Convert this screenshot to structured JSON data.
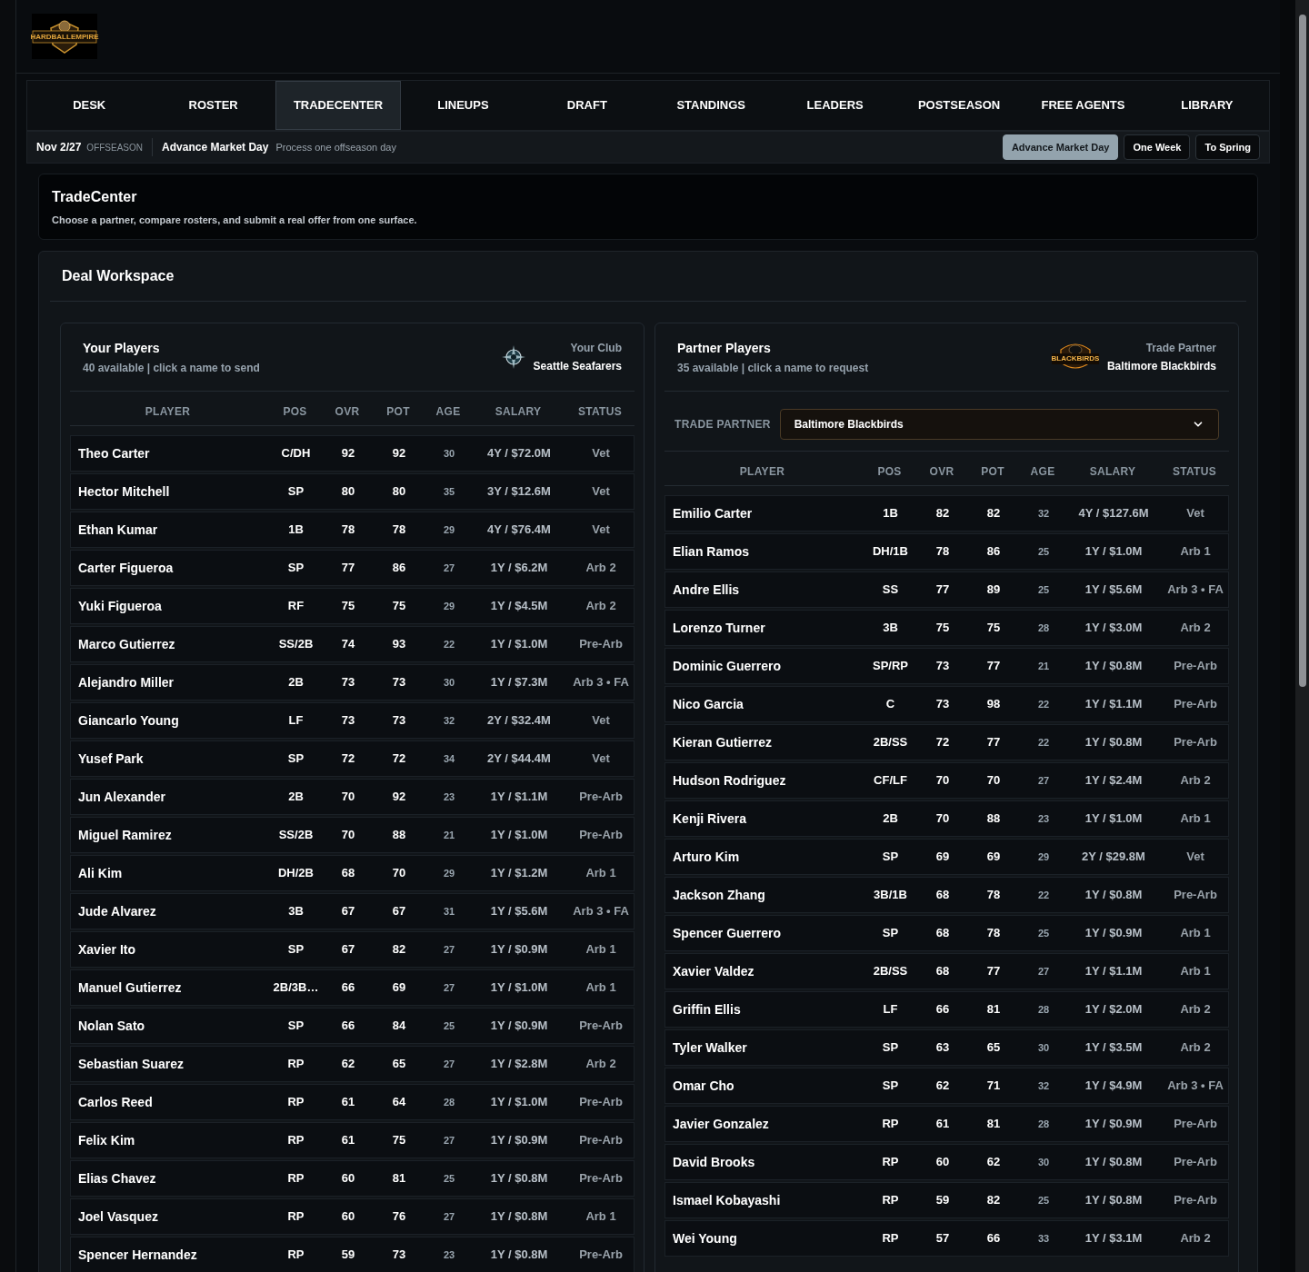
{
  "header": {
    "logo_text": "HARDBALLEMPIRE"
  },
  "nav": [
    {
      "label": "DESK",
      "selected": false
    },
    {
      "label": "ROSTER",
      "selected": false
    },
    {
      "label": "TRADECENTER",
      "selected": true
    },
    {
      "label": "LINEUPS",
      "selected": false
    },
    {
      "label": "DRAFT",
      "selected": false
    },
    {
      "label": "STANDINGS",
      "selected": false
    },
    {
      "label": "LEADERS",
      "selected": false
    },
    {
      "label": "POSTSEASON",
      "selected": false
    },
    {
      "label": "FREE AGENTS",
      "selected": false
    },
    {
      "label": "LIBRARY",
      "selected": false
    }
  ],
  "status_bar": {
    "date": "Nov 2/27",
    "phase": "OFFSEASON",
    "action": "Advance Market Day",
    "action_hint": "Process one offseason day",
    "buttons": [
      {
        "label": "Advance Market Day",
        "selected": true
      },
      {
        "label": "One Week",
        "selected": false
      },
      {
        "label": "To Spring",
        "selected": false
      }
    ]
  },
  "intro": {
    "title": "TradeCenter",
    "subtitle": "Choose a partner, compare rosters, and submit a real offer from one surface."
  },
  "workspace": {
    "title": "Deal Workspace",
    "panels": [
      {
        "kind": "own",
        "title": "Your Players",
        "subtitle": "40 available | click a name to send",
        "club_label": "Your Club",
        "club_name": "Seattle Seafarers",
        "columns": [
          "PLAYER",
          "POS",
          "OVR",
          "POT",
          "AGE",
          "SALARY",
          "STATUS"
        ],
        "rows": [
          [
            "Theo Carter",
            "C/DH",
            "92",
            "92",
            "30",
            "4Y / $72.0M",
            "Vet"
          ],
          [
            "Hector Mitchell",
            "SP",
            "80",
            "80",
            "35",
            "3Y / $12.6M",
            "Vet"
          ],
          [
            "Ethan Kumar",
            "1B",
            "78",
            "78",
            "29",
            "4Y / $76.4M",
            "Vet"
          ],
          [
            "Carter Figueroa",
            "SP",
            "77",
            "86",
            "27",
            "1Y / $6.2M",
            "Arb 2"
          ],
          [
            "Yuki Figueroa",
            "RF",
            "75",
            "75",
            "29",
            "1Y / $4.5M",
            "Arb 2"
          ],
          [
            "Marco Gutierrez",
            "SS/2B",
            "74",
            "93",
            "22",
            "1Y / $1.0M",
            "Pre-Arb"
          ],
          [
            "Alejandro Miller",
            "2B",
            "73",
            "73",
            "30",
            "1Y / $7.3M",
            "Arb 3 • FA"
          ],
          [
            "Giancarlo Young",
            "LF",
            "73",
            "73",
            "32",
            "2Y / $32.4M",
            "Vet"
          ],
          [
            "Yusef Park",
            "SP",
            "72",
            "72",
            "34",
            "2Y / $44.4M",
            "Vet"
          ],
          [
            "Jun Alexander",
            "2B",
            "70",
            "92",
            "23",
            "1Y / $1.1M",
            "Pre-Arb"
          ],
          [
            "Miguel Ramirez",
            "SS/2B",
            "70",
            "88",
            "21",
            "1Y / $1.0M",
            "Pre-Arb"
          ],
          [
            "Ali Kim",
            "DH/2B",
            "68",
            "70",
            "29",
            "1Y / $1.2M",
            "Arb 1"
          ],
          [
            "Jude Alvarez",
            "3B",
            "67",
            "67",
            "31",
            "1Y / $5.6M",
            "Arb 3 • FA"
          ],
          [
            "Xavier Ito",
            "SP",
            "67",
            "82",
            "27",
            "1Y / $0.9M",
            "Arb 1"
          ],
          [
            "Manuel Gutierrez",
            "2B/3B…",
            "66",
            "69",
            "27",
            "1Y / $1.0M",
            "Arb 1"
          ],
          [
            "Nolan Sato",
            "SP",
            "66",
            "84",
            "25",
            "1Y / $0.9M",
            "Pre-Arb"
          ],
          [
            "Sebastian Suarez",
            "RP",
            "62",
            "65",
            "27",
            "1Y / $2.8M",
            "Arb 2"
          ],
          [
            "Carlos Reed",
            "RP",
            "61",
            "64",
            "28",
            "1Y / $1.0M",
            "Pre-Arb"
          ],
          [
            "Felix Kim",
            "RP",
            "61",
            "75",
            "27",
            "1Y / $0.9M",
            "Pre-Arb"
          ],
          [
            "Elias Chavez",
            "RP",
            "60",
            "81",
            "25",
            "1Y / $0.8M",
            "Pre-Arb"
          ],
          [
            "Joel Vasquez",
            "RP",
            "60",
            "76",
            "27",
            "1Y / $0.8M",
            "Arb 1"
          ],
          [
            "Spencer Hernandez",
            "RP",
            "59",
            "73",
            "23",
            "1Y / $0.8M",
            "Pre-Arb"
          ]
        ]
      },
      {
        "kind": "partner",
        "title": "Partner Players",
        "subtitle": "35 available | click a name to request",
        "club_label": "Trade Partner",
        "club_name": "Baltimore Blackbirds",
        "logo_text": "BLACKBIRDS",
        "select": {
          "label": "TRADE PARTNER",
          "value": "Baltimore Blackbirds"
        },
        "columns": [
          "PLAYER",
          "POS",
          "OVR",
          "POT",
          "AGE",
          "SALARY",
          "STATUS"
        ],
        "rows": [
          [
            "Emilio Carter",
            "1B",
            "82",
            "82",
            "32",
            "4Y / $127.6M",
            "Vet"
          ],
          [
            "Elian Ramos",
            "DH/1B",
            "78",
            "86",
            "25",
            "1Y / $1.0M",
            "Arb 1"
          ],
          [
            "Andre Ellis",
            "SS",
            "77",
            "89",
            "25",
            "1Y / $5.6M",
            "Arb 3 • FA"
          ],
          [
            "Lorenzo Turner",
            "3B",
            "75",
            "75",
            "28",
            "1Y / $3.0M",
            "Arb 2"
          ],
          [
            "Dominic Guerrero",
            "SP/RP",
            "73",
            "77",
            "21",
            "1Y / $0.8M",
            "Pre-Arb"
          ],
          [
            "Nico Garcia",
            "C",
            "73",
            "98",
            "22",
            "1Y / $1.1M",
            "Pre-Arb"
          ],
          [
            "Kieran Gutierrez",
            "2B/SS",
            "72",
            "77",
            "22",
            "1Y / $0.8M",
            "Pre-Arb"
          ],
          [
            "Hudson Rodriguez",
            "CF/LF",
            "70",
            "70",
            "27",
            "1Y / $2.4M",
            "Arb 2"
          ],
          [
            "Kenji Rivera",
            "2B",
            "70",
            "88",
            "23",
            "1Y / $1.0M",
            "Arb 1"
          ],
          [
            "Arturo Kim",
            "SP",
            "69",
            "69",
            "29",
            "2Y / $29.8M",
            "Vet"
          ],
          [
            "Jackson Zhang",
            "3B/1B",
            "68",
            "78",
            "22",
            "1Y / $0.8M",
            "Pre-Arb"
          ],
          [
            "Spencer Guerrero",
            "SP",
            "68",
            "78",
            "25",
            "1Y / $0.9M",
            "Arb 1"
          ],
          [
            "Xavier Valdez",
            "2B/SS",
            "68",
            "77",
            "27",
            "1Y / $1.1M",
            "Arb 1"
          ],
          [
            "Griffin Ellis",
            "LF",
            "66",
            "81",
            "28",
            "1Y / $2.0M",
            "Arb 2"
          ],
          [
            "Tyler Walker",
            "SP",
            "63",
            "65",
            "30",
            "1Y / $3.5M",
            "Arb 2"
          ],
          [
            "Omar Cho",
            "SP",
            "62",
            "71",
            "32",
            "1Y / $4.9M",
            "Arb 3 • FA"
          ],
          [
            "Javier Gonzalez",
            "RP",
            "61",
            "81",
            "28",
            "1Y / $0.9M",
            "Pre-Arb"
          ],
          [
            "David Brooks",
            "RP",
            "60",
            "62",
            "30",
            "1Y / $0.8M",
            "Pre-Arb"
          ],
          [
            "Ismael Kobayashi",
            "RP",
            "59",
            "82",
            "25",
            "1Y / $0.8M",
            "Pre-Arb"
          ],
          [
            "Wei Young",
            "RP",
            "57",
            "66",
            "33",
            "1Y / $3.1M",
            "Arb 2"
          ]
        ]
      }
    ]
  }
}
